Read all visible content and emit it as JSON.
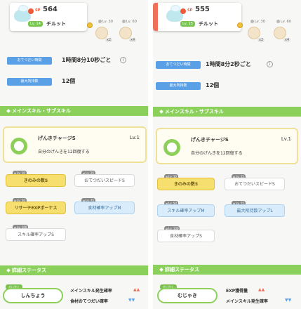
{
  "left": {
    "header": {
      "sp_label": "SP",
      "sp": "564",
      "lv": "Lv. 14",
      "name": "チルット"
    },
    "ingredients": [
      {
        "lv": "Lv. 30",
        "count": "x2"
      },
      {
        "lv": "Lv. 60",
        "count": "x4"
      }
    ],
    "stats": [
      {
        "label": "おてつだい時間",
        "value": "1時間8分10秒ごと"
      },
      {
        "label": "最大所持数",
        "value": "12個"
      }
    ],
    "section_skills": "メインスキル・サブスキル",
    "main_skill": {
      "name": "げんきチャージS",
      "lv": "Lv.1",
      "desc": "自分のげんきを12回復する"
    },
    "subskills": [
      {
        "lv": "Lv. 10",
        "label": "きのみの数S",
        "style": "gold"
      },
      {
        "lv": "Lv. 25",
        "label": "おてつだいスピードS",
        "style": "white"
      },
      {
        "lv": "Lv. 50",
        "label": "リサーチEXPボーナス",
        "style": "gold"
      },
      {
        "lv": "Lv. 75",
        "label": "食材確率アップM",
        "style": "blue"
      },
      {
        "lv": "Lv. 100",
        "label": "スキル確率アップS",
        "style": "white"
      }
    ],
    "section_detail": "詳細ステータス",
    "nature_tag": "せいかく",
    "nature": "しんちょう",
    "effects": [
      {
        "label": "メインスキル発生確率",
        "arrows": "▲▲",
        "dir": "up"
      },
      {
        "label": "食材おてつだい確率",
        "arrows": "▼▼",
        "dir": "down"
      }
    ]
  },
  "right": {
    "header": {
      "sp_label": "SP",
      "sp": "555",
      "lv": "Lv. 15",
      "name": "チルット"
    },
    "ingredients": [
      {
        "lv": "Lv. 30",
        "count": "x2"
      },
      {
        "lv": "Lv. 60",
        "count": "x4"
      }
    ],
    "stats": [
      {
        "label": "おてつだい時間",
        "value": "1時間8分2秒ごと"
      },
      {
        "label": "最大所持数",
        "value": "12個"
      }
    ],
    "section_skills": "メインスキル・サブスキル",
    "main_skill": {
      "name": "げんきチャージS",
      "lv": "Lv.1",
      "desc": "自分のげんきを12回復する"
    },
    "subskills": [
      {
        "lv": "Lv. 10",
        "label": "きのみの数S",
        "style": "gold"
      },
      {
        "lv": "Lv. 25",
        "label": "おてつだいスピードS",
        "style": "white"
      },
      {
        "lv": "Lv. 50",
        "label": "スキル確率アップM",
        "style": "blue"
      },
      {
        "lv": "Lv. 75",
        "label": "最大所持数アップL",
        "style": "blue"
      },
      {
        "lv": "Lv. 100",
        "label": "食材確率アップS",
        "style": "white"
      }
    ],
    "section_detail": "詳細ステータス",
    "nature_tag": "せいかく",
    "nature": "むじゃき",
    "effects": [
      {
        "label": "EXP獲得量",
        "arrows": "▲▲",
        "dir": "up"
      },
      {
        "label": "メインスキル発生確率",
        "arrows": "▼▼",
        "dir": "down"
      }
    ]
  },
  "colors": {
    "section_green": "#8bd05b",
    "stat_blue": "#5aa0e6",
    "accent_red": "#ef6f5a",
    "gold": "#f7df6f"
  }
}
